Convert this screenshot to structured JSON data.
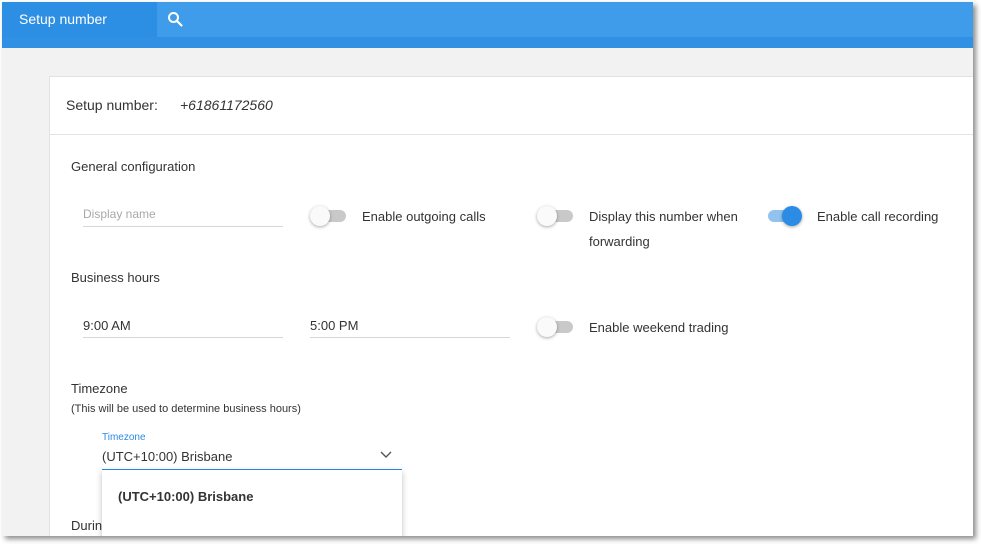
{
  "app": {
    "title": "Setup number"
  },
  "header": {
    "label": "Setup number:",
    "number": "+61861172560"
  },
  "general": {
    "title": "General configuration",
    "display_name_placeholder": "Display name",
    "toggles": [
      {
        "label": "Enable outgoing calls",
        "on": false
      },
      {
        "label_line1": "Display this number when",
        "label_line2": "forwarding",
        "on": false
      },
      {
        "label": "Enable call recording",
        "on": true
      }
    ]
  },
  "business_hours": {
    "title": "Business hours",
    "start": "9:00 AM",
    "end": "5:00 PM",
    "weekend_label": "Enable weekend trading",
    "weekend_on": false
  },
  "timezone": {
    "title": "Timezone",
    "note": "(This will be used to determine business hours)",
    "field_label": "Timezone",
    "value": "(UTC+10:00) Brisbane",
    "options": [
      "(UTC+10:00) Brisbane"
    ]
  },
  "next_section": {
    "title_partial": "Durin"
  },
  "colors": {
    "accent": "#2b8be5",
    "topbar": "#4aa2ea"
  }
}
